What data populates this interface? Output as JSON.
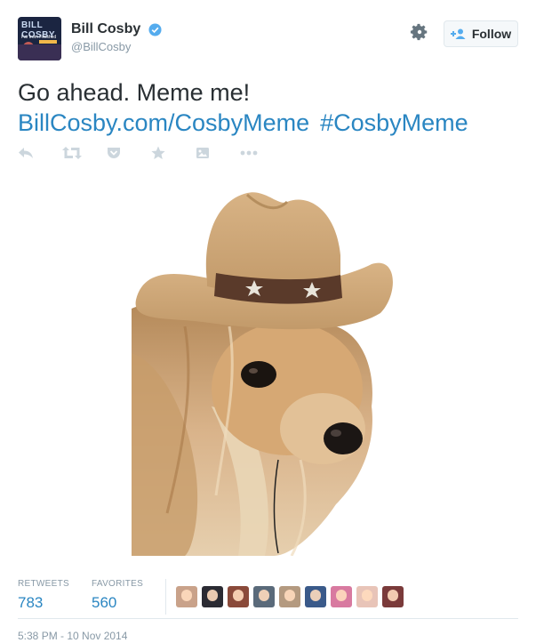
{
  "user": {
    "display_name": "Bill Cosby",
    "handle": "@BillCosby",
    "avatar_text_1": "BILL COSBY",
    "avatar_text_2": "Far from Finished",
    "verified": true
  },
  "header": {
    "follow_label": "Follow",
    "gear_icon": "gear-icon",
    "follow_icon": "add-user-icon"
  },
  "tweet": {
    "text": "Go ahead. Meme me!",
    "link": "BillCosby.com/CosbyMeme",
    "hashtag": "#CosbyMeme"
  },
  "actions": [
    {
      "icon": "reply-icon"
    },
    {
      "icon": "retweet-icon"
    },
    {
      "icon": "pocket-icon"
    },
    {
      "icon": "favorite-star-icon"
    },
    {
      "icon": "media-icon"
    },
    {
      "icon": "more-icon"
    }
  ],
  "stats": {
    "retweets_label": "RETWEETS",
    "retweets_value": "783",
    "favorites_label": "FAVORITES",
    "favorites_value": "560"
  },
  "favoriters_colors": [
    "#c9a28a",
    "#2b2b33",
    "#8a4a3a",
    "#5a6a7a",
    "#b49a80",
    "#3a5a8a",
    "#d87aa0",
    "#e8c4b8",
    "#7a3a3a"
  ],
  "timestamp": "5:38 PM - 10 Nov 2014",
  "colors": {
    "link": "#2a86c2",
    "muted": "#8899a6",
    "verified": "#55acee"
  }
}
